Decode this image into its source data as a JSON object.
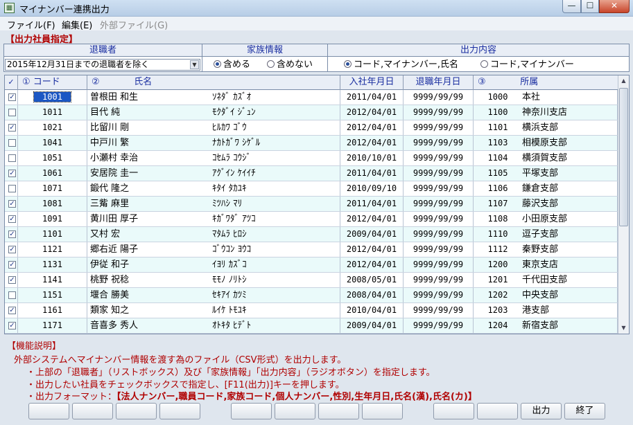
{
  "window": {
    "title": "マイナンバー連携出力",
    "icon": "app-icon"
  },
  "menu": {
    "file": "ファイル(F)",
    "edit": "編集(E)",
    "external": "外部ファイル(G)"
  },
  "section_title": "【出力社員指定】",
  "filters": {
    "retired": {
      "header": "退職者",
      "selected": "2015年12月31日までの退職者を除く"
    },
    "family": {
      "header": "家族情報",
      "options": [
        "含める",
        "含めない"
      ],
      "selected": 0
    },
    "output": {
      "header": "出力内容",
      "options": [
        "コード,マイナンバー,氏名",
        "コード,マイナンバー"
      ],
      "selected": 0
    }
  },
  "grid": {
    "headers": {
      "check": "✓",
      "code": "① コード",
      "name": "②            氏名",
      "join": "入社年月日",
      "retire": "退職年月日",
      "dept": "③            所属"
    },
    "rows": [
      {
        "checked": true,
        "code": "1001",
        "name": "曽根田 和生",
        "kana": "ｿﾈﾀﾞ ｶｽﾞｵ",
        "join": "2011/04/01",
        "retire": "9999/99/99",
        "dcode": "1000",
        "dept": "本社"
      },
      {
        "checked": false,
        "code": "1011",
        "name": "目代 純",
        "kana": "ﾓｸﾀﾞｲ ｼﾞｭﾝ",
        "join": "2012/04/01",
        "retire": "9999/99/99",
        "dcode": "1100",
        "dept": "神奈川支店"
      },
      {
        "checked": true,
        "code": "1021",
        "name": "比留川 剛",
        "kana": "ﾋﾙｶﾜ ｺﾞｳ",
        "join": "2012/04/01",
        "retire": "9999/99/99",
        "dcode": "1101",
        "dept": "横浜支部"
      },
      {
        "checked": false,
        "code": "1041",
        "name": "中戸川 繁",
        "kana": "ﾅｶﾄｶﾞﾜ ｼｹﾞﾙ",
        "join": "2012/04/01",
        "retire": "9999/99/99",
        "dcode": "1103",
        "dept": "相模原支部"
      },
      {
        "checked": false,
        "code": "1051",
        "name": "小瀬村 幸治",
        "kana": "ｺｾﾑﾗ ｺｳｼﾞ",
        "join": "2010/10/01",
        "retire": "9999/99/99",
        "dcode": "1104",
        "dept": "横須賀支部"
      },
      {
        "checked": true,
        "code": "1061",
        "name": "安居院 圭一",
        "kana": "ｱｸﾞｲﾝ ｹｲｲﾁ",
        "join": "2011/04/01",
        "retire": "9999/99/99",
        "dcode": "1105",
        "dept": "平塚支部"
      },
      {
        "checked": false,
        "code": "1071",
        "name": "鍛代 隆之",
        "kana": "ｷﾀｲ ﾀｶﾕｷ",
        "join": "2010/09/10",
        "retire": "9999/99/99",
        "dcode": "1106",
        "dept": "鎌倉支部"
      },
      {
        "checked": true,
        "code": "1081",
        "name": "三觜 麻里",
        "kana": "ﾐﾂﾊｼ ﾏﾘ",
        "join": "2011/04/01",
        "retire": "9999/99/99",
        "dcode": "1107",
        "dept": "藤沢支部"
      },
      {
        "checked": true,
        "code": "1091",
        "name": "黄川田 厚子",
        "kana": "ｷｶﾞﾜﾀﾞ ｱﾂｺ",
        "join": "2012/04/01",
        "retire": "9999/99/99",
        "dcode": "1108",
        "dept": "小田原支部"
      },
      {
        "checked": true,
        "code": "1101",
        "name": "又村 宏",
        "kana": "ﾏﾀﾑﾗ ﾋﾛｼ",
        "join": "2009/04/01",
        "retire": "9999/99/99",
        "dcode": "1110",
        "dept": "逗子支部"
      },
      {
        "checked": true,
        "code": "1121",
        "name": "郷右近 陽子",
        "kana": "ｺﾞｳｺﾝ ﾖｳｺ",
        "join": "2012/04/01",
        "retire": "9999/99/99",
        "dcode": "1112",
        "dept": "秦野支部"
      },
      {
        "checked": true,
        "code": "1131",
        "name": "伊従 和子",
        "kana": "ｲﾖﾘ ｶｽﾞｺ",
        "join": "2012/04/01",
        "retire": "9999/99/99",
        "dcode": "1200",
        "dept": "東京支店"
      },
      {
        "checked": true,
        "code": "1141",
        "name": "桃野 祝稔",
        "kana": "ﾓﾓﾉ ﾉﾘﾄｼ",
        "join": "2008/05/01",
        "retire": "9999/99/99",
        "dcode": "1201",
        "dept": "千代田支部"
      },
      {
        "checked": false,
        "code": "1151",
        "name": "堰合 勝美",
        "kana": "ｾｷｱｲ ｶﾂﾐ",
        "join": "2008/04/01",
        "retire": "9999/99/99",
        "dcode": "1202",
        "dept": "中央支部"
      },
      {
        "checked": true,
        "code": "1161",
        "name": "類家 知之",
        "kana": "ﾙｲｹ ﾄﾓﾕｷ",
        "join": "2010/04/01",
        "retire": "9999/99/99",
        "dcode": "1203",
        "dept": "港支部"
      },
      {
        "checked": true,
        "code": "1171",
        "name": "音喜多 秀人",
        "kana": "ｵﾄｷﾀ ﾋﾃﾞﾄ",
        "join": "2009/04/01",
        "retire": "9999/99/99",
        "dcode": "1204",
        "dept": "新宿支部"
      }
    ]
  },
  "description": {
    "title": "【機能説明】",
    "line1": "外部システムへマイナンバー情報を渡す為のファイル（CSV形式）を出力します。",
    "line2": "・上部の「退職者」（リストボックス）及び「家族情報」「出力内容」（ラジオボタン）を指定します。",
    "line3": "・出力したい社員をチェックボックスで指定し、[F11(出力)]キーを押します。",
    "line4_prefix": "・出力フォーマット：",
    "line4_format": "【法人ナンバー,職員コード,家族コード,個人ナンバー,性別,生年月日,氏名(漢),氏名(カ)】"
  },
  "fkeys": [
    "",
    "",
    "",
    "",
    "",
    "",
    "",
    "",
    "",
    "",
    "出力",
    "終了"
  ]
}
